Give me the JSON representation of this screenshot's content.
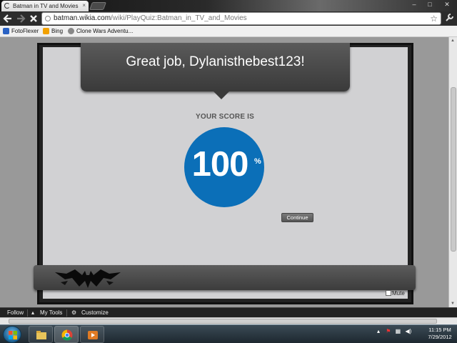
{
  "browser": {
    "tab_title": "Batman in TV and Movies",
    "tab_close": "×",
    "url_host": "batman.wikia.com",
    "url_path": "/wiki/PlayQuiz:Batman_in_TV_and_Movies",
    "back_icon": "arrow-left",
    "forward_icon": "arrow-right",
    "stop_icon": "x",
    "star_icon": "star",
    "wrench_icon": "wrench",
    "window_minimize": "–",
    "window_maximize": "□",
    "window_close": "✕"
  },
  "bookmarks": [
    {
      "label": "FotoFlexer",
      "color": "#2a62c4"
    },
    {
      "label": "Bing",
      "color": "#f2a100"
    },
    {
      "label": "Clone Wars Adventu...",
      "color": "#888888"
    }
  ],
  "quiz": {
    "banner": "Great job, Dylanisthebest123!",
    "score_label": "YOUR SCORE IS",
    "score_value": "100",
    "score_unit": "%",
    "score_color": "#0b6fb8",
    "continue_label": "Continue",
    "mute_label": "Mute"
  },
  "wikia_toolbar": {
    "follow": "Follow",
    "my_tools": "My Tools",
    "customize": "Customize"
  },
  "taskbar": {
    "time": "11:15 PM",
    "date": "7/29/2012",
    "apps": [
      "file-explorer-icon",
      "chrome-icon",
      "media-player-icon"
    ]
  }
}
